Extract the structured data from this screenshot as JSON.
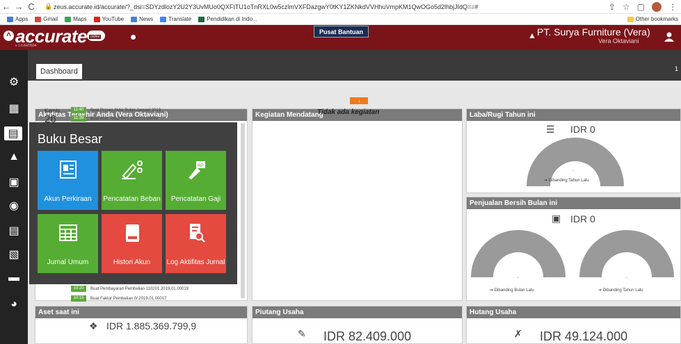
{
  "browser": {
    "url": "zeus.accurate.id/accurate/?_dsi=SDYzdlozY2U2Y3UvMUo0QXFITU1oTnRXL0w5czlmVXFDazgwY0tKY1ZKNkdVVHhuVmpKM1QwOGo5d2lhbjJIdQ==#",
    "bookmarks": [
      "Apps",
      "Gmail",
      "Maps",
      "YouTube",
      "News",
      "Translate",
      "Pendidikan di Indo..."
    ],
    "other_bookmarks": "Other bookmarks"
  },
  "app": {
    "logo": "accurate",
    "logo_sub": "online",
    "version": "v 1.0.647/604",
    "help_button": "Pusat Bantuan",
    "company": "PT. Surya Furniture (Vera)",
    "user": "Vera Oktaviani",
    "tab": "Dashboard",
    "tab_count": "1"
  },
  "activity": {
    "title": "Aktifitas Terakhir Anda (Vera Oktaviani)",
    "day_label": "Kamis",
    "day_num": "26",
    "items": [
      {
        "time": "11:40",
        "text": "Buat Proses Akhir Bulan Januari 2019"
      },
      {
        "time": "11:39",
        "text": "Buat Aset Tetap FA 1.2019.01.00002"
      },
      {
        "time": "10:20",
        "text": "Buat Pembayaran Pembelian 110201.2019.01.00019"
      },
      {
        "time": "10:15",
        "text": "Buat Faktur Pembelian 0/.2019.01.00017"
      }
    ]
  },
  "events": {
    "title": "Kegiatan Mendatang",
    "empty": "Tidak ada kegiatan"
  },
  "profit": {
    "title": "Laba/Rugi Tahun ini",
    "value": "IDR 0",
    "dash": "-",
    "compare": "Dibanding Tahun Lalu"
  },
  "sales": {
    "title": "Penjualan Bersih Bulan ini",
    "value": "IDR 0",
    "dash": "-",
    "compare_month": "Dibanding Bulan Lalu",
    "compare_year": "Dibanding Tahun Lalu"
  },
  "assets": {
    "title": "Aset saat ini",
    "value": "IDR 1.885.369.799,9"
  },
  "receivables": {
    "title": "Piutang Usaha",
    "value": "IDR 82.409.000"
  },
  "payables": {
    "title": "Hutang Usaha",
    "value": "IDR 49.124.000"
  },
  "ledger_menu": {
    "title": "Buku Besar",
    "tiles": [
      {
        "label": "Akun Perkiraan",
        "color": "#1f91de"
      },
      {
        "label": "Pencatatan Beban",
        "color": "#55ad33"
      },
      {
        "label": "Pencatatan Gaji",
        "color": "#55ad33"
      },
      {
        "label": "Jurnal Umum",
        "color": "#55ad33"
      },
      {
        "label": "Histori Akun",
        "color": "#e44a3f"
      },
      {
        "label": "Log Aktifitas Jurnal",
        "color": "#e44a3f"
      }
    ]
  },
  "colors": {
    "brand": "#7b1419",
    "sidebar": "#232323",
    "panel_header": "#7b7b7b",
    "gauge": "#9a9a9a",
    "accent": "#f07a1e"
  }
}
